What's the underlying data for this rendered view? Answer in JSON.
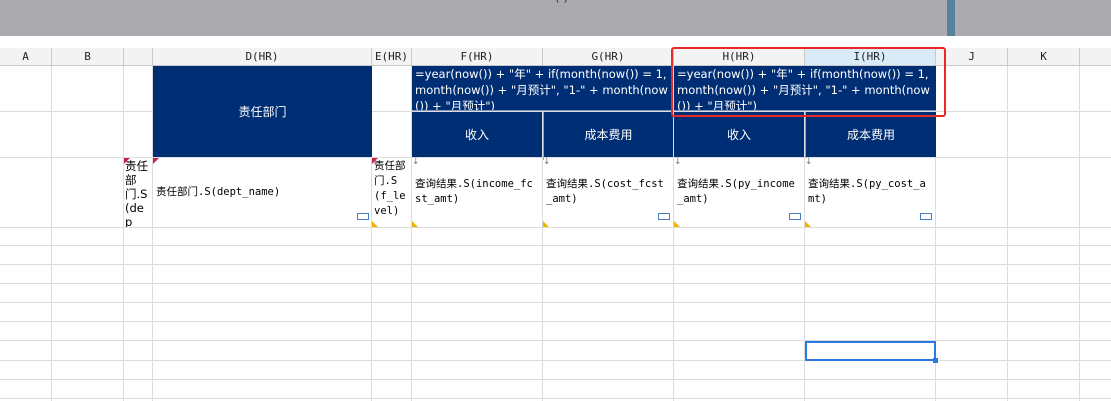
{
  "topbar": {
    "title_fragment": "(   )"
  },
  "columns": [
    "A",
    "B",
    "",
    "D(HR)",
    "E(HR)",
    "F(HR)",
    "G(HR)",
    "H(HR)",
    "I(HR)",
    "J",
    "K"
  ],
  "header": {
    "dept_label": "责任部门",
    "formula_text": "=year(now()) + \"年\" + if(month(now()) = 1, month(now()) + \"月预计\", \"1-\" + month(now()) + \"月预计\")",
    "income_label": "收入",
    "cost_label": "成本费用"
  },
  "row": {
    "c_text": "责任部门.S(dep",
    "d_text": "责任部门.S(dept_name)",
    "e_text": "责任部门.S(f_level)",
    "f_text": "查询结果.S(income_fcst_amt)",
    "g_text": "查询结果.S(cost_fcst_amt)",
    "h_text": "查询结果.S(py_income_amt)",
    "i_text": "查询结果.S(py_cost_amt)"
  }
}
